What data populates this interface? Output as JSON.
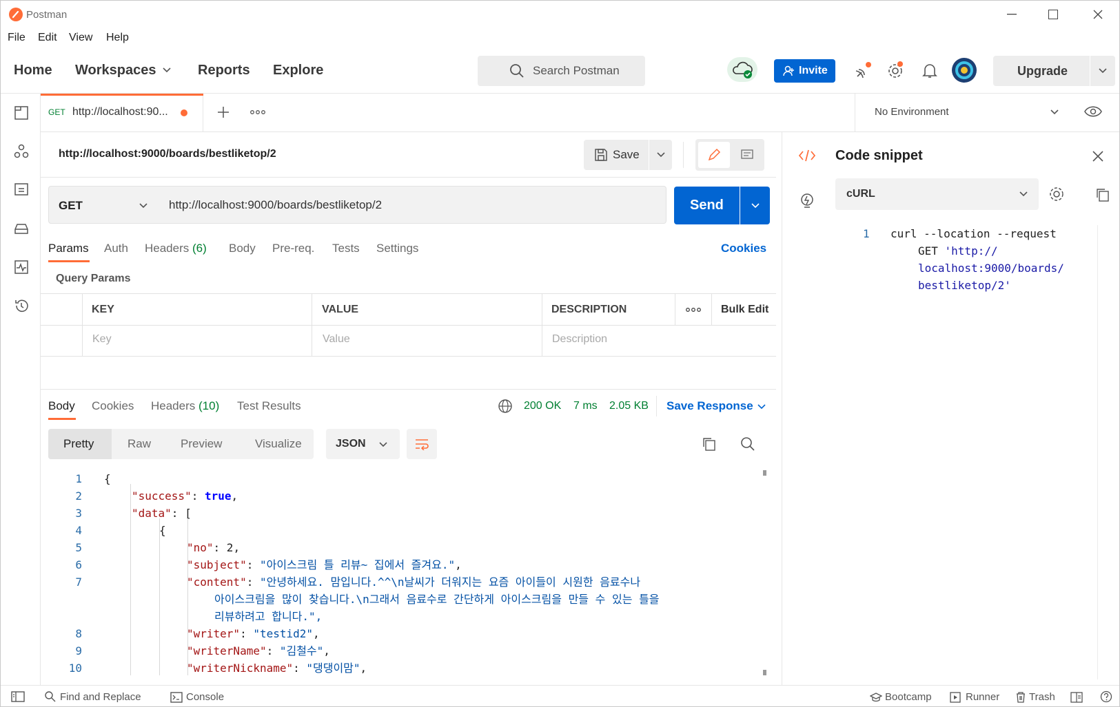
{
  "app": {
    "title": "Postman"
  },
  "menu": [
    "File",
    "Edit",
    "View",
    "Help"
  ],
  "nav": {
    "home": "Home",
    "workspaces": "Workspaces",
    "reports": "Reports",
    "explore": "Explore",
    "search_placeholder": "Search Postman",
    "invite": "Invite",
    "upgrade": "Upgrade"
  },
  "tab": {
    "method": "GET",
    "title": "http://localhost:90..."
  },
  "environment": {
    "label": "No Environment"
  },
  "request": {
    "name": "http://localhost:9000/boards/bestliketop/2",
    "save": "Save",
    "method": "GET",
    "url": "http://localhost:9000/boards/bestliketop/2",
    "send": "Send",
    "tabs": {
      "params": "Params",
      "auth": "Auth",
      "headers": "Headers",
      "headers_count": "(6)",
      "body": "Body",
      "prereq": "Pre-req.",
      "tests": "Tests",
      "settings": "Settings"
    },
    "cookies": "Cookies",
    "query_params": "Query Params",
    "table": {
      "key": "KEY",
      "value": "VALUE",
      "description": "DESCRIPTION",
      "bulk_edit": "Bulk Edit",
      "key_ph": "Key",
      "value_ph": "Value",
      "desc_ph": "Description"
    }
  },
  "response": {
    "tabs": {
      "body": "Body",
      "cookies": "Cookies",
      "headers": "Headers",
      "headers_count": "(10)",
      "tests": "Test Results"
    },
    "status": "200 OK",
    "time": "7 ms",
    "size": "2.05 KB",
    "save_response": "Save Response",
    "view_modes": [
      "Pretty",
      "Raw",
      "Preview",
      "Visualize"
    ],
    "format": "JSON",
    "code_lines": [
      {
        "n": "1",
        "text": "{"
      },
      {
        "n": "2",
        "key": "\"success\"",
        "val": "true",
        "vtype": "kw",
        "trail": ","
      },
      {
        "n": "3",
        "key": "\"data\"",
        "val": "[",
        "vtype": "p"
      },
      {
        "n": "4",
        "text": "{"
      },
      {
        "n": "5",
        "key": "\"no\"",
        "val": "2",
        "vtype": "p",
        "trail": ","
      },
      {
        "n": "6",
        "key": "\"subject\"",
        "val": "\"아이스크림 틀 리뷰~ 집에서 즐겨요.\"",
        "vtype": "s",
        "trail": ","
      },
      {
        "n": "7",
        "key": "\"content\"",
        "val": "\"안녕하세요. 맘입니다.^^\\n날씨가 더워지는 요즘 아이들이 시원한 음료수나",
        "vtype": "s"
      },
      {
        "n": "",
        "cont": "아이스크림을 많이 찾습니다.\\n그래서 음료수로 간단하게 아이스크림을 만들 수 있는 틀을"
      },
      {
        "n": "",
        "cont": "리뷰하려고 합니다.\",",
        "vtype": "s"
      },
      {
        "n": "8",
        "key": "\"writer\"",
        "val": "\"testid2\"",
        "vtype": "s",
        "trail": ","
      },
      {
        "n": "9",
        "key": "\"writerName\"",
        "val": "\"김철수\"",
        "vtype": "s",
        "trail": ","
      },
      {
        "n": "10",
        "key": "\"writerNickname\"",
        "val": "\"댕댕이맘\"",
        "vtype": "s",
        "trail": ","
      }
    ]
  },
  "snippet": {
    "title": "Code snippet",
    "lang": "cURL",
    "line_no": "1",
    "line1": "curl --location --request",
    "line2a": "GET ",
    "line2b": "'http://",
    "line3": "localhost:9000/boards/",
    "line4": "bestliketop/2'"
  },
  "footer": {
    "find": "Find and Replace",
    "console": "Console",
    "bootcamp": "Bootcamp",
    "runner": "Runner",
    "trash": "Trash"
  },
  "colors": {
    "accent": "#ff6c37",
    "blue": "#0265d2",
    "green": "#007f31"
  }
}
